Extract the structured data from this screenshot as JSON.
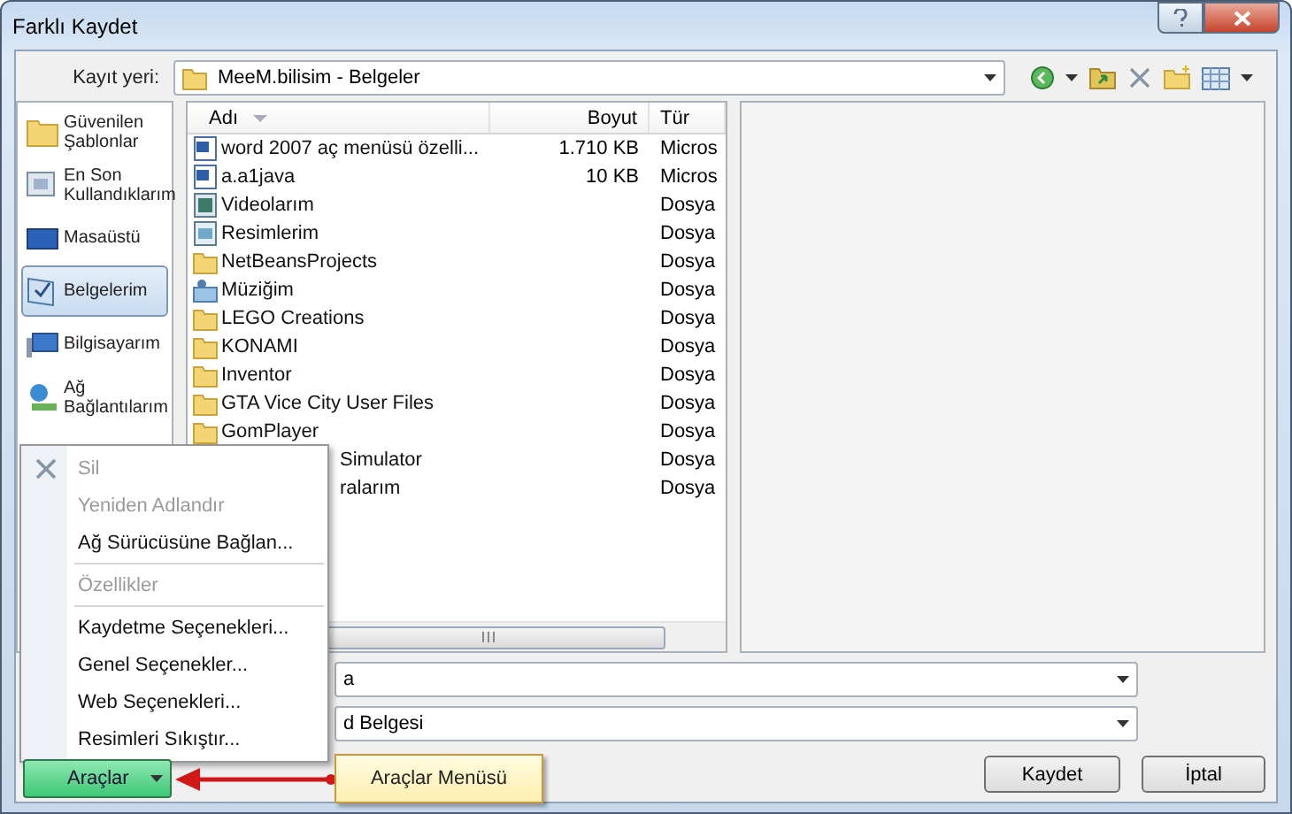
{
  "window": {
    "title": "Farklı Kaydet"
  },
  "location": {
    "label": "Kayıt yeri:",
    "value": "MeeM.bilisim - Belgeler"
  },
  "sidebar": {
    "items": [
      {
        "label": "Güvenilen\nŞablonlar",
        "kind": "folder",
        "selected": false
      },
      {
        "label": "En Son\nKullandıklarım",
        "kind": "recent",
        "selected": false
      },
      {
        "label": "Masaüstü",
        "kind": "desktop",
        "selected": false
      },
      {
        "label": "Belgelerim",
        "kind": "documents",
        "selected": true
      },
      {
        "label": "Bilgisayarım",
        "kind": "computer",
        "selected": false
      },
      {
        "label": "Ağ\nBağlantılarım",
        "kind": "network",
        "selected": false
      }
    ]
  },
  "table": {
    "columns": [
      "Adı",
      "Boyut",
      "Tür"
    ],
    "rows": [
      {
        "name": "word 2007 aç menüsü özelli...",
        "size": "1.710 KB",
        "type": "Micros",
        "kind": "doc",
        "covered": false
      },
      {
        "name": "a.a1java",
        "size": "10 KB",
        "type": "Micros",
        "kind": "doc",
        "covered": false
      },
      {
        "name": "Videolarım",
        "size": "",
        "type": "Dosya",
        "kind": "video",
        "covered": false
      },
      {
        "name": "Resimlerim",
        "size": "",
        "type": "Dosya",
        "kind": "picture",
        "covered": false
      },
      {
        "name": "NetBeansProjects",
        "size": "",
        "type": "Dosya",
        "kind": "folder",
        "covered": false
      },
      {
        "name": "Müziğim",
        "size": "",
        "type": "Dosya",
        "kind": "music",
        "covered": false
      },
      {
        "name": "LEGO Creations",
        "size": "",
        "type": "Dosya",
        "kind": "folder",
        "covered": false
      },
      {
        "name": "KONAMI",
        "size": "",
        "type": "Dosya",
        "kind": "folder",
        "covered": false
      },
      {
        "name": "Inventor",
        "size": "",
        "type": "Dosya",
        "kind": "folder",
        "covered": false
      },
      {
        "name": "GTA Vice City User Files",
        "size": "",
        "type": "Dosya",
        "kind": "folder",
        "covered": false
      },
      {
        "name": "GomPlayer",
        "size": "",
        "type": "Dosya",
        "kind": "folder",
        "covered": false
      },
      {
        "name": "Simulator",
        "size": "",
        "type": "Dosya",
        "covered": true
      },
      {
        "name": "ralarım",
        "size": "",
        "type": "Dosya",
        "covered": true
      }
    ]
  },
  "file_name": {
    "value": "a"
  },
  "file_type": {
    "value": "d Belgesi"
  },
  "tools_menu": {
    "items": [
      {
        "kind": "item",
        "label": "Sil",
        "disabled": true,
        "icon": true
      },
      {
        "kind": "item",
        "label": "Yeniden Adlandır",
        "disabled": true
      },
      {
        "kind": "item",
        "label": "Ağ Sürücüsüne Bağlan...",
        "disabled": false
      },
      {
        "kind": "separator"
      },
      {
        "kind": "item",
        "label": "Özellikler",
        "disabled": true
      },
      {
        "kind": "separator"
      },
      {
        "kind": "item",
        "label": "Kaydetme Seçenekleri...",
        "disabled": false
      },
      {
        "kind": "item",
        "label": "Genel Seçenekler...",
        "disabled": false
      },
      {
        "kind": "item",
        "label": "Web Seçenekleri...",
        "disabled": false
      },
      {
        "kind": "item",
        "label": "Resimleri Sıkıştır...",
        "disabled": false
      }
    ]
  },
  "tools_button": {
    "label": "Araçlar"
  },
  "callout": {
    "label": "Araçlar Menüsü"
  },
  "buttons": [
    "Kaydet",
    "İptal"
  ]
}
